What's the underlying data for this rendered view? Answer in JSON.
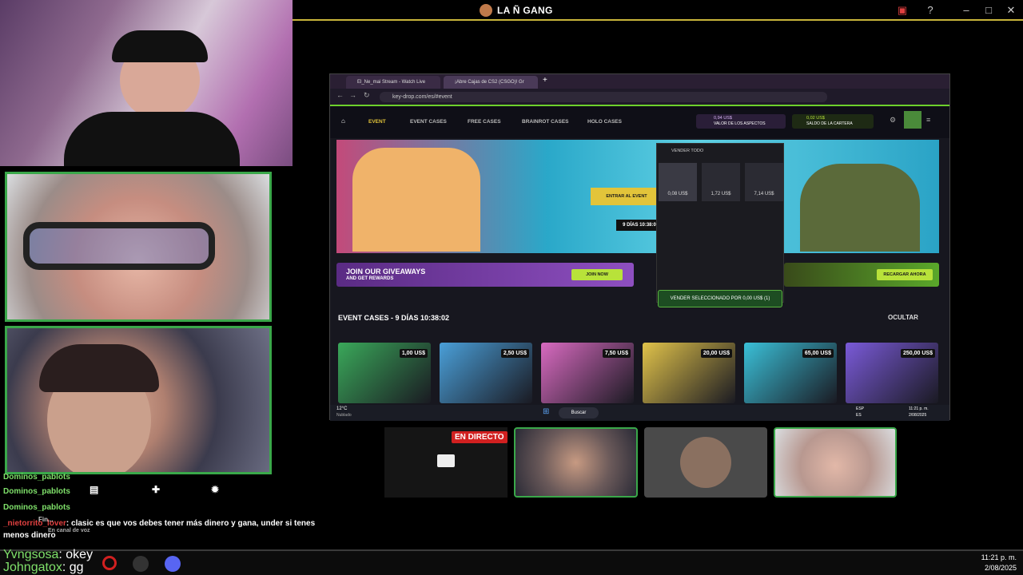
{
  "app": {
    "title": "LA Ñ GANG"
  },
  "browser": {
    "tabs": [
      "El_Ne_mai Stream - Watch Live",
      "¡Abre Cajas de CS2 (CSGO)! Gr"
    ],
    "url": "key-drop.com/es/#event",
    "nav": [
      "EVENT",
      "EVENT CASES",
      "FREE CASES",
      "BRAINROT CASES",
      "HOLO CASES"
    ],
    "wallet": {
      "skins_value": "0,94 US$",
      "skins_label": "VALOR DE LOS ASPECTOS",
      "balance": "0,02 US$",
      "balance_label": "SALDO DE LA CARTERA"
    },
    "banner": {
      "cta": "ENTRAR AL EVENT",
      "countdown": "9 DÍAS 10:38:0"
    },
    "panel": {
      "header": "VENDER TODO",
      "skins": [
        {
          "price": "0,08 US$"
        },
        {
          "price": "1,72 US$"
        },
        {
          "price": "7,14 US$"
        }
      ],
      "sell_button": "VENDER SELECCIONADO POR 0,00 US$ (1)"
    },
    "giveaway": {
      "line1": "JOIN OUR GIVEAWAYS",
      "line2": "AND GET REWARDS",
      "button": "JOIN NOW"
    },
    "recharge_button": "RECARGAR AHORA",
    "event_title": "EVENT CASES - 9 DÍAS 10:38:02",
    "hide": "OCULTAR",
    "cases": [
      {
        "price": "1,00 US$",
        "color": "#3aa85a"
      },
      {
        "price": "2,50 US$",
        "color": "#4a9fd8"
      },
      {
        "price": "7,50 US$",
        "color": "#d86ac0"
      },
      {
        "price": "20,00 US$",
        "color": "#e0c24a"
      },
      {
        "price": "65,00 US$",
        "color": "#3ac0d8"
      },
      {
        "price": "250,00 US$",
        "color": "#7a5ad8"
      }
    ],
    "taskbar": {
      "weather": "12°C",
      "weather_sub": "Nublado",
      "search": "Buscar",
      "lang": "ESP",
      "lang2": "ES",
      "time": "11:21 p. m.",
      "date": "2/08/2025"
    }
  },
  "live_badge": "EN DIRECTO",
  "chat": [
    {
      "user": "Dominos_pablots",
      "text": "",
      "color": "green"
    },
    {
      "user": "Dominos_pablots",
      "text": "",
      "color": "green"
    },
    {
      "user": "Dominos_pablots",
      "text": "",
      "color": "green"
    },
    {
      "user": "_nietorrito_lover",
      "text": ": clasic es que vos debes tener más dinero y gana, under si tenes",
      "color": "red"
    },
    {
      "user": "",
      "text": "menos dinero",
      "color": "white"
    },
    {
      "user": "Yvngsosa",
      "text": ": okey",
      "color": "green"
    },
    {
      "user": "Johngatox",
      "text": ": gg",
      "color": "green"
    }
  ],
  "voice": {
    "label": "Fin...",
    "sub": "En canal de voz"
  },
  "clock": {
    "time": "11:21 p. m.",
    "date": "2/08/2025"
  },
  "colors": {
    "accent": "#6dd12c",
    "border_green": "#3aa84a",
    "live_red": "#d12020"
  }
}
